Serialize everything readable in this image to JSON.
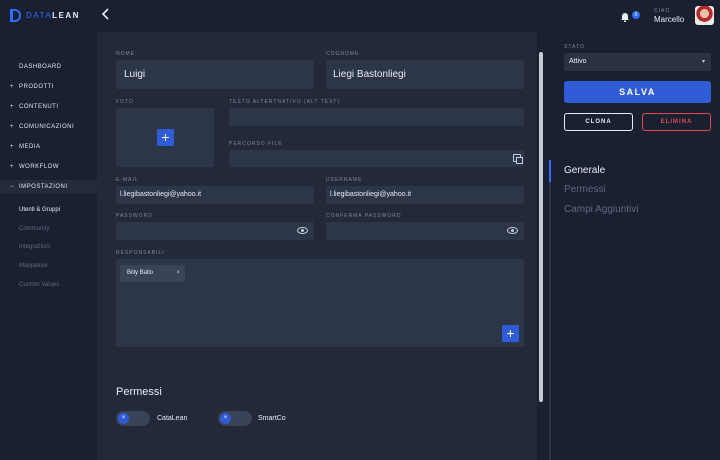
{
  "app": {
    "logo_a": "DATA",
    "logo_b": "LEAN",
    "back_icon": "chevron-left-icon"
  },
  "topbar": {
    "notifications_count": "6",
    "greeting": "CIAO",
    "user_name": "Marcello"
  },
  "sidebar": {
    "items": [
      {
        "plus": "",
        "label": "DASHBOARD"
      },
      {
        "plus": "+",
        "label": "PRODOTTI"
      },
      {
        "plus": "+",
        "label": "CONTENUTI"
      },
      {
        "plus": "+",
        "label": "COMUNICAZIONI"
      },
      {
        "plus": "+",
        "label": "MEDIA"
      },
      {
        "plus": "+",
        "label": "WORKFLOW"
      },
      {
        "plus": "−",
        "label": "IMPOSTAZIONI"
      }
    ],
    "subitems": [
      "Utenti & Gruppi",
      "Community",
      "Integrazioni",
      "Mappature",
      "Custom Values"
    ]
  },
  "form": {
    "nome_label": "NOME",
    "nome_value": "Luigi",
    "cognome_label": "COGNOME",
    "cognome_value": "Liegi Bastonliegi",
    "foto_label": "FOTO",
    "alt_label": "TESTO ALTERTNATIVO (ALT TEXT)",
    "alt_value": "",
    "percorso_label": "PERCORSO FILE",
    "percorso_value": "",
    "email_label": "E-MAIL",
    "email_value": "l.liegibastonliegi@yahoo.it",
    "username_label": "USERNAME",
    "username_value": "l.liegibastonliegi@yahoo.it",
    "password_label": "PASSWORD",
    "confirm_label": "CONFERMA PASSWORD",
    "responsabili_label": "RESPONSABILI",
    "chip_label": "Billy Ballo",
    "chip_remove": "×",
    "permessi_title": "Permessi",
    "toggles": [
      {
        "label": "CataLean",
        "state_glyph": "×"
      },
      {
        "label": "SmartCo",
        "state_glyph": "×"
      }
    ]
  },
  "right": {
    "stato_label": "STATO",
    "stato_value": "Attivo",
    "save": "SALVA",
    "clone": "CLONA",
    "delete": "ELIMINA",
    "tabs": [
      "Generale",
      "Permessi",
      "Campi Aggiuntivi"
    ],
    "active_tab": "Generale"
  },
  "colors": {
    "accent": "#2f5bd6",
    "danger": "#e0494e",
    "bg": "#1a2030",
    "panel": "#222a3a"
  }
}
